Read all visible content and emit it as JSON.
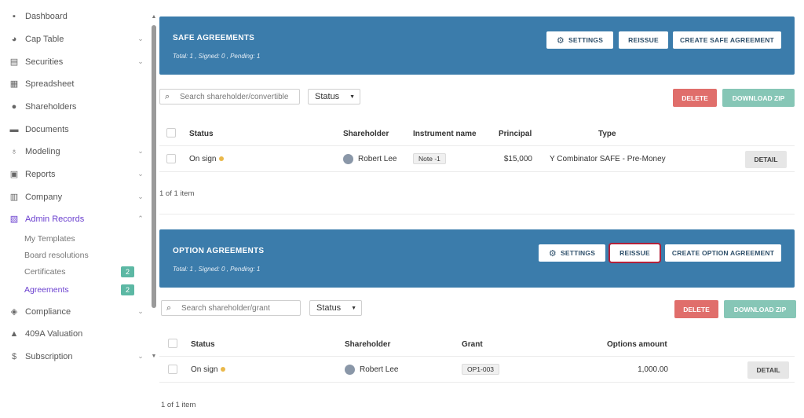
{
  "sidebar": {
    "items": [
      {
        "label": "Dashboard",
        "icon": "dashboard-icon",
        "chevron": false
      },
      {
        "label": "Cap Table",
        "icon": "pie-chart-icon",
        "chevron": true
      },
      {
        "label": "Securities",
        "icon": "clipboard-icon",
        "chevron": true
      },
      {
        "label": "Spreadsheet",
        "icon": "spreadsheet-icon",
        "chevron": false
      },
      {
        "label": "Shareholders",
        "icon": "person-icon",
        "chevron": false
      },
      {
        "label": "Documents",
        "icon": "folder-icon",
        "chevron": false
      },
      {
        "label": "Modeling",
        "icon": "lightbulb-icon",
        "chevron": true
      },
      {
        "label": "Reports",
        "icon": "report-icon",
        "chevron": true
      },
      {
        "label": "Company",
        "icon": "building-icon",
        "chevron": true
      },
      {
        "label": "Admin Records",
        "icon": "records-icon",
        "chevron": true,
        "active": true
      }
    ],
    "sub_items": [
      {
        "label": "My Templates"
      },
      {
        "label": "Board resolutions"
      },
      {
        "label": "Certificates",
        "badge": "2"
      },
      {
        "label": "Agreements",
        "badge": "2",
        "active": true
      }
    ],
    "lower_items": [
      {
        "label": "Compliance",
        "icon": "shield-check-icon",
        "chevron": true
      },
      {
        "label": "409A Valuation",
        "icon": "chart-up-icon",
        "chevron": false
      },
      {
        "label": "Subscription",
        "icon": "dollar-circle-icon",
        "chevron": true
      }
    ]
  },
  "safe": {
    "title": "SAFE AGREEMENTS",
    "summary": "Total: 1 , Signed: 0 , Pending: 1",
    "settings_label": "SETTINGS",
    "reissue_label": "REISSUE",
    "create_label": "CREATE SAFE AGREEMENT",
    "search_placeholder": "Search shareholder/convertible",
    "status_label": "Status",
    "delete_label": "DELETE",
    "zip_label": "DOWNLOAD ZIP",
    "columns": {
      "status": "Status",
      "shareholder": "Shareholder",
      "instrument": "Instrument name",
      "principal": "Principal",
      "type": "Type"
    },
    "rows": [
      {
        "status": "On sign",
        "shareholder": "Robert Lee",
        "instrument": "Note -1",
        "principal": "$15,000",
        "type": "Y Combinator SAFE - Pre-Money",
        "detail": "DETAIL"
      }
    ],
    "pager": "1 of 1 item"
  },
  "option": {
    "title": "OPTION AGREEMENTS",
    "summary": "Total: 1 , Signed: 0 , Pending: 1",
    "settings_label": "SETTINGS",
    "reissue_label": "REISSUE",
    "create_label": "CREATE OPTION AGREEMENT",
    "search_placeholder": "Search shareholder/grant",
    "status_label": "Status",
    "delete_label": "DELETE",
    "zip_label": "DOWNLOAD ZIP",
    "columns": {
      "status": "Status",
      "shareholder": "Shareholder",
      "grant": "Grant",
      "options": "Options amount"
    },
    "rows": [
      {
        "status": "On sign",
        "shareholder": "Robert Lee",
        "grant": "OP1-003",
        "options": "1,000.00",
        "detail": "DETAIL"
      }
    ],
    "pager": "1 of 1 item"
  },
  "colors": {
    "header_blue": "#3b7cab",
    "accent_purple": "#6a3fcf",
    "delete_red": "#e06e6b",
    "zip_teal": "#86c6b6",
    "badge_teal": "#5cb8a4",
    "highlight": "#b3213a"
  }
}
